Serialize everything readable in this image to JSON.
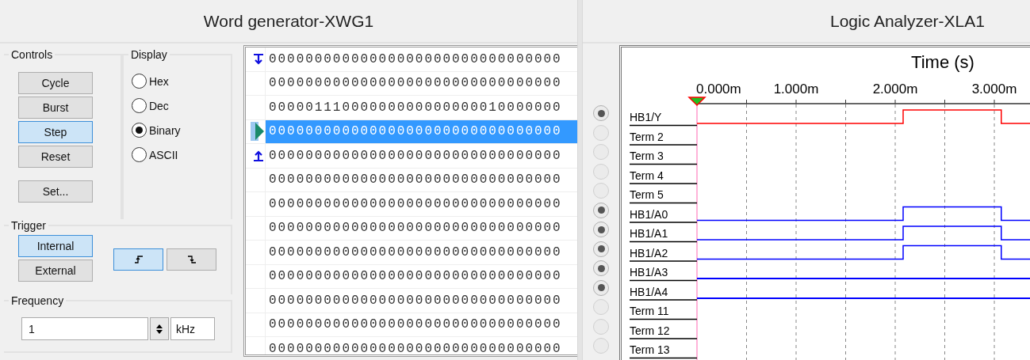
{
  "word_generator": {
    "title": "Word generator-XWG1",
    "controls": {
      "label": "Controls",
      "buttons": [
        {
          "label": "Cycle",
          "selected": false
        },
        {
          "label": "Burst",
          "selected": false
        },
        {
          "label": "Step",
          "selected": true
        },
        {
          "label": "Reset",
          "selected": false
        },
        {
          "label": "Set...",
          "selected": false
        }
      ]
    },
    "display": {
      "label": "Display",
      "options": [
        {
          "label": "Hex",
          "selected": false
        },
        {
          "label": "Dec",
          "selected": false
        },
        {
          "label": "Binary",
          "selected": true
        },
        {
          "label": "ASCII",
          "selected": false
        }
      ]
    },
    "trigger": {
      "label": "Trigger",
      "sources": [
        {
          "label": "Internal",
          "selected": true
        },
        {
          "label": "External",
          "selected": false
        }
      ],
      "edges": [
        {
          "kind": "rising",
          "selected": true
        },
        {
          "kind": "falling",
          "selected": false
        }
      ]
    },
    "frequency": {
      "label": "Frequency",
      "value": "1",
      "unit": "kHz"
    },
    "words": [
      {
        "value": "00000000000000000000000000000000",
        "selected": false,
        "kind": "start"
      },
      {
        "value": "00000000000000000000000000000000",
        "selected": false
      },
      {
        "value": "00000111000000000000000010000000",
        "selected": false
      },
      {
        "value": "00000000000000000000000000000000",
        "selected": true,
        "kind": "cursor"
      },
      {
        "value": "00000000000000000000000000000000",
        "selected": false,
        "kind": "end"
      },
      {
        "value": "00000000000000000000000000000000",
        "selected": false
      },
      {
        "value": "00000000000000000000000000000000",
        "selected": false
      },
      {
        "value": "00000000000000000000000000000000",
        "selected": false
      },
      {
        "value": "00000000000000000000000000000000",
        "selected": false
      },
      {
        "value": "00000000000000000000000000000000",
        "selected": false
      },
      {
        "value": "00000000000000000000000000000000",
        "selected": false
      },
      {
        "value": "00000000000000000000000000000000",
        "selected": false
      },
      {
        "value": "00000000000000000000000000000000",
        "selected": false
      }
    ]
  },
  "logic_analyzer": {
    "title": "Logic Analyzer-XLA1",
    "time_axis": {
      "title": "Time (s)",
      "ticks": [
        "0.000m",
        "1.000m",
        "2.000m",
        "3.000m"
      ]
    },
    "channels": [
      {
        "name": "HB1/Y",
        "on": true,
        "kind": "pulse",
        "color": "#ff0000"
      },
      {
        "name": "Term 2",
        "on": false,
        "kind": "none"
      },
      {
        "name": "Term 3",
        "on": false,
        "kind": "none"
      },
      {
        "name": "Term 4",
        "on": false,
        "kind": "none"
      },
      {
        "name": "Term 5",
        "on": false,
        "kind": "none"
      },
      {
        "name": "HB1/A0",
        "on": true,
        "kind": "pulse",
        "color": "#0000ff"
      },
      {
        "name": "HB1/A1",
        "on": true,
        "kind": "pulse",
        "color": "#0000ff"
      },
      {
        "name": "HB1/A2",
        "on": true,
        "kind": "pulse",
        "color": "#0000ff"
      },
      {
        "name": "HB1/A3",
        "on": true,
        "kind": "low",
        "color": "#0000ff"
      },
      {
        "name": "HB1/A4",
        "on": true,
        "kind": "low",
        "color": "#0000ff"
      },
      {
        "name": "Term 11",
        "on": false,
        "kind": "none"
      },
      {
        "name": "Term 12",
        "on": false,
        "kind": "none"
      },
      {
        "name": "Term 13",
        "on": false,
        "kind": "none"
      }
    ]
  }
}
